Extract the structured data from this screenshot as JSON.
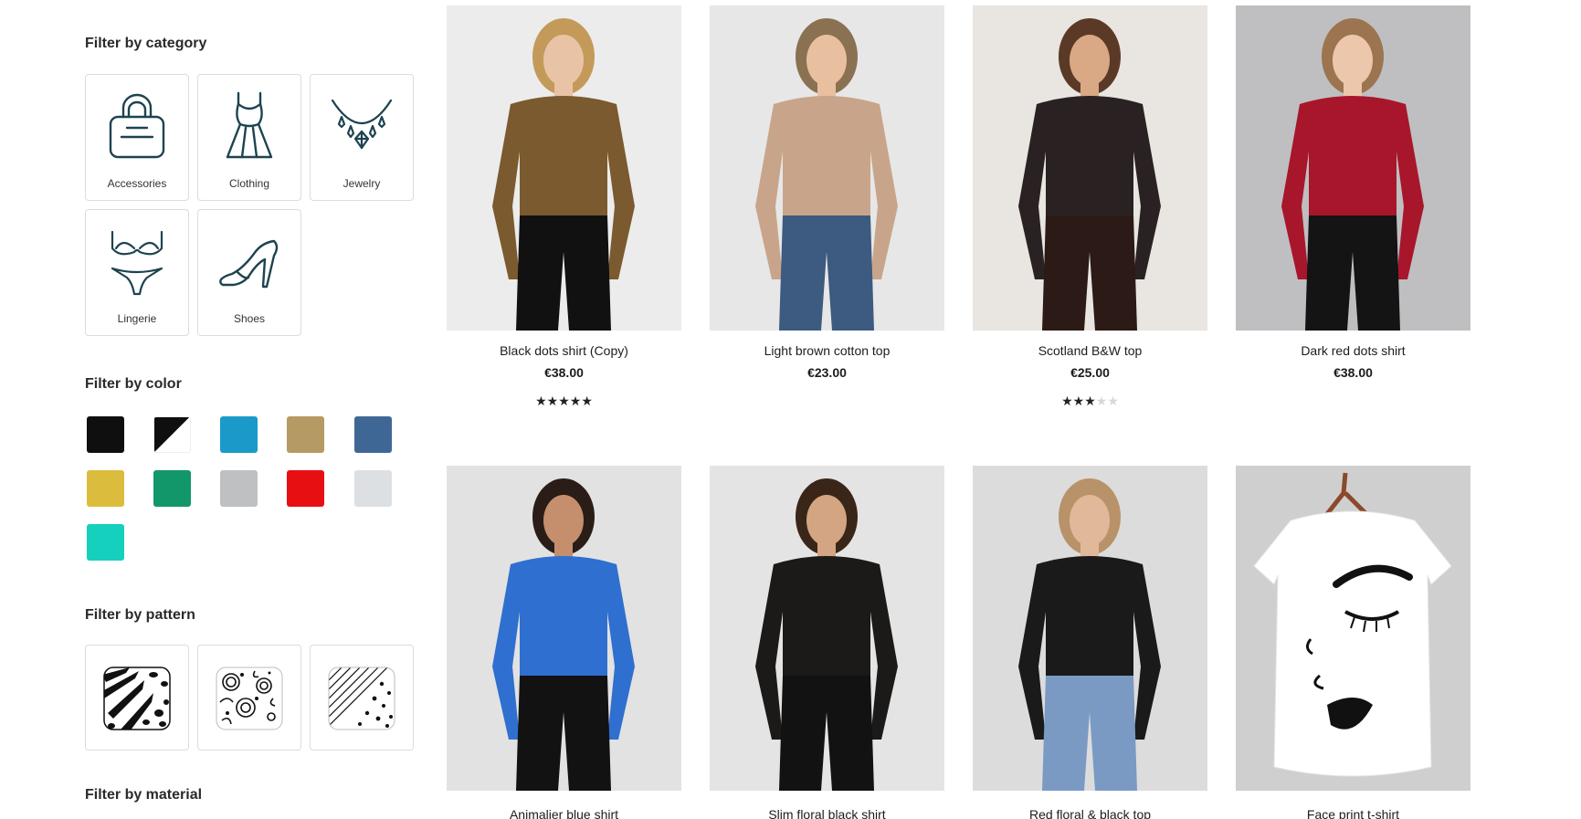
{
  "filters": {
    "category": {
      "title": "Filter by category",
      "items": [
        {
          "label": "Accessories",
          "icon": "handbag-icon"
        },
        {
          "label": "Clothing",
          "icon": "dress-icon"
        },
        {
          "label": "Jewelry",
          "icon": "necklace-icon"
        },
        {
          "label": "Lingerie",
          "icon": "lingerie-icon"
        },
        {
          "label": "Shoes",
          "icon": "high-heel-icon"
        }
      ]
    },
    "color": {
      "title": "Filter by color",
      "swatches": [
        "#0f0f0f",
        "black-white",
        "#1a9ac9",
        "#b59a63",
        "#3f6796",
        "#dcbc3c",
        "#12976a",
        "#bfc0c2",
        "#e80f12",
        "#dde0e2",
        "#15d0bc"
      ]
    },
    "pattern": {
      "title": "Filter by pattern",
      "items": [
        {
          "icon": "animal-print-pattern-icon"
        },
        {
          "icon": "floral-pattern-icon"
        },
        {
          "icon": "stripes-dots-pattern-icon"
        }
      ]
    },
    "material": {
      "title": "Filter by material"
    }
  },
  "products": [
    {
      "name": "Black dots shirt (Copy)",
      "price": "€38.00",
      "rating": 5,
      "colors": {
        "bg": "#ececec",
        "top": "#7a5a2e",
        "bottom": "#111111",
        "skin": "#e9c3a6",
        "hair": "#c49a5a"
      }
    },
    {
      "name": "Light brown cotton top",
      "price": "€23.00",
      "rating": 0,
      "colors": {
        "bg": "#e7e7e7",
        "top": "#c8a58a",
        "bottom": "#3d5a80",
        "skin": "#e8c0a0",
        "hair": "#8a7152"
      }
    },
    {
      "name": "Scotland B&W top",
      "price": "€25.00",
      "rating": 3,
      "colors": {
        "bg": "#e9e5e0",
        "top": "#2a2222",
        "bottom": "#2b1a16",
        "skin": "#d9a884",
        "hair": "#5a3a26"
      }
    },
    {
      "name": "Dark red dots shirt",
      "price": "€38.00",
      "rating": 0,
      "colors": {
        "bg": "#bfbfc1",
        "top": "#a8162c",
        "bottom": "#141414",
        "skin": "#ecc7ac",
        "hair": "#9c7550"
      }
    },
    {
      "name": "Animalier blue shirt",
      "price": "",
      "rating": 0,
      "colors": {
        "bg": "#e2e2e2",
        "top": "#2f6fcf",
        "bottom": "#121212",
        "skin": "#c58f6d",
        "hair": "#2a1d17"
      }
    },
    {
      "name": "Slim floral black shirt",
      "price": "",
      "rating": 0,
      "colors": {
        "bg": "#e4e4e4",
        "top": "#1c1a18",
        "bottom": "#121212",
        "skin": "#d4a583",
        "hair": "#3a2618"
      }
    },
    {
      "name": "Red floral & black top",
      "price": "",
      "rating": 0,
      "colors": {
        "bg": "#dcdcdc",
        "top": "#1a1a1a",
        "bottom": "#7a9ac4",
        "skin": "#e2b89a",
        "hair": "#b89268"
      }
    },
    {
      "name": "Face print t-shirt",
      "price": "",
      "rating": 0,
      "colors": {
        "bg": "#cfcfcf",
        "top": "#ffffff",
        "bottom": "#cfcfcf",
        "skin": "#cfcfcf",
        "hair": "#8a4a2a"
      }
    }
  ]
}
